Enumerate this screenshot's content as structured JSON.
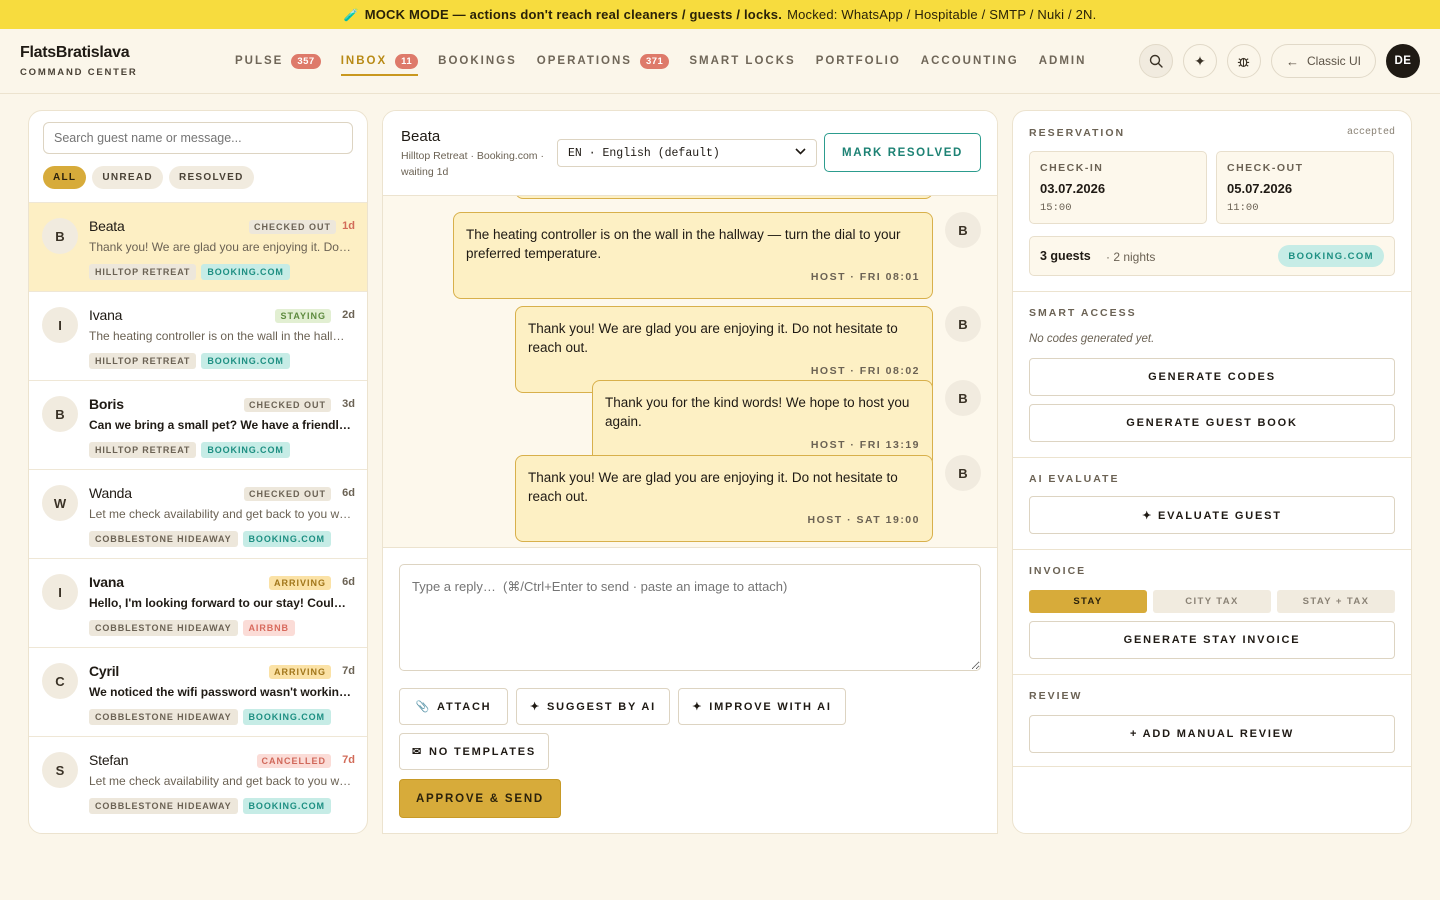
{
  "banner": {
    "strong": "MOCK MODE — actions don't reach real cleaners / guests / locks.",
    "rest": "Mocked: WhatsApp / Hospitable / SMTP / Nuki / 2N."
  },
  "brand": {
    "name": "FlatsBratislava",
    "sub": "COMMAND CENTER"
  },
  "nav": {
    "tabs": [
      {
        "label": "PULSE",
        "badge": "357"
      },
      {
        "label": "INBOX",
        "badge": "11"
      },
      {
        "label": "BOOKINGS",
        "badge": ""
      },
      {
        "label": "OPERATIONS",
        "badge": "371"
      },
      {
        "label": "SMART LOCKS",
        "badge": ""
      },
      {
        "label": "PORTFOLIO",
        "badge": ""
      },
      {
        "label": "ACCOUNTING",
        "badge": ""
      },
      {
        "label": "ADMIN",
        "badge": ""
      }
    ],
    "active_tab": "INBOX",
    "classic_label": "Classic UI",
    "user_initials": "DE"
  },
  "inbox": {
    "search_placeholder": "Search guest name or message...",
    "filters": [
      "ALL",
      "UNREAD",
      "RESOLVED"
    ],
    "active_filter": "ALL",
    "conversations": [
      {
        "initial": "B",
        "name": "Beata",
        "status": "CHECKED OUT",
        "ago": "1d",
        "message": "Thank you! We are glad you are enjoying it. Do not hesitate to reach out.",
        "property": "HILLTOP RETREAT",
        "channel": "BOOKING.COM",
        "selected": true,
        "unread": false
      },
      {
        "initial": "I",
        "name": "Ivana",
        "status": "STAYING",
        "ago": "2d",
        "message": "The heating controller is on the wall in the hallway — turn the dial to your preferred temperature.",
        "property": "HILLTOP RETREAT",
        "channel": "BOOKING.COM",
        "selected": false,
        "unread": false
      },
      {
        "initial": "B",
        "name": "Boris",
        "status": "CHECKED OUT",
        "ago": "3d",
        "message": "Can we bring a small pet? We have a friendly dog.",
        "property": "HILLTOP RETREAT",
        "channel": "BOOKING.COM",
        "selected": false,
        "unread": true
      },
      {
        "initial": "W",
        "name": "Wanda",
        "status": "CHECKED OUT",
        "ago": "6d",
        "message": "Let me check availability and get back to you within the hour.",
        "property": "COBBLESTONE HIDEAWAY",
        "channel": "BOOKING.COM",
        "selected": false,
        "unread": false
      },
      {
        "initial": "I",
        "name": "Ivana",
        "status": "ARRIVING",
        "ago": "6d",
        "message": "Hello, I'm looking forward to our stay! Could you send the check-in instructions?",
        "property": "COBBLESTONE HIDEAWAY",
        "channel": "AIRBNB",
        "selected": false,
        "unread": true
      },
      {
        "initial": "C",
        "name": "Cyril",
        "status": "ARRIVING",
        "ago": "7d",
        "message": "We noticed the wifi password wasn't working. Could you help?",
        "property": "COBBLESTONE HIDEAWAY",
        "channel": "BOOKING.COM",
        "selected": false,
        "unread": true
      },
      {
        "initial": "S",
        "name": "Stefan",
        "status": "CANCELLED",
        "ago": "7d",
        "message": "Let me check availability and get back to you within the hour.",
        "property": "COBBLESTONE HIDEAWAY",
        "channel": "BOOKING.COM",
        "selected": false,
        "unread": false
      }
    ]
  },
  "thread": {
    "guest_name": "Beata",
    "meta": "Hilltop Retreat · Booking.com · waiting 1d",
    "language": "EN · English (default)",
    "resolve_label": "MARK RESOLVED",
    "messages": [
      {
        "text": "The heating controller is on the wall in the hallway — turn the dial to your preferred temperature.",
        "meta": "HOST · FRI 08:01",
        "avatar": "B"
      },
      {
        "text": "Thank you! We are glad you are enjoying it. Do not hesitate to reach out.",
        "meta": "HOST · FRI 08:02",
        "avatar": "B"
      },
      {
        "text": "Thank you for the kind words! We hope to host you again.",
        "meta": "HOST · FRI 13:19",
        "avatar": "B"
      },
      {
        "text": "Thank you! We are glad you are enjoying it. Do not hesitate to reach out.",
        "meta": "HOST · SAT 19:00",
        "avatar": "B"
      }
    ],
    "reply_placeholder": "Type a reply…  (⌘/Ctrl+Enter to send · paste an image to attach)",
    "attach_label": "ATTACH",
    "suggest_label": "SUGGEST BY AI",
    "improve_label": "IMPROVE WITH AI",
    "templates_label": "NO TEMPLATES",
    "approve_label": "APPROVE & SEND"
  },
  "reservation": {
    "title": "RESERVATION",
    "state": "accepted",
    "checkin_label": "CHECK-IN",
    "checkin_date": "03.07.2026",
    "checkin_time": "15:00",
    "checkout_label": "CHECK-OUT",
    "checkout_date": "05.07.2026",
    "checkout_time": "11:00",
    "guests": "3 guests",
    "nights": "· 2 nights",
    "channel": "BOOKING.COM"
  },
  "smart_access": {
    "title": "SMART ACCESS",
    "empty": "No codes generated yet.",
    "generate_codes": "GENERATE CODES",
    "generate_guestbook": "GENERATE GUEST BOOK"
  },
  "ai_evaluate": {
    "title": "AI EVALUATE",
    "button": "✦ EVALUATE GUEST"
  },
  "invoice": {
    "title": "INVOICE",
    "options": [
      "STAY",
      "CITY TAX",
      "STAY + TAX"
    ],
    "active_option": "STAY",
    "button": "GENERATE STAY INVOICE"
  },
  "review": {
    "title": "REVIEW",
    "button": "+ ADD MANUAL REVIEW"
  },
  "colors": {
    "accent": "#d7ab3a",
    "banner": "#f7dc3e",
    "bubble": "#fdf0c4",
    "teal": "#1d8f82"
  }
}
